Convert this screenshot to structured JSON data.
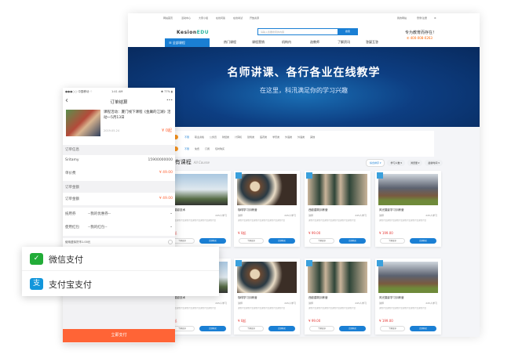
{
  "desktop": {
    "topbar": {
      "links": [
        "网站首页",
        "活动中心",
        "大家小组",
        "在线问答",
        "在线考试",
        "开放资源"
      ],
      "right": [
        "我的网站",
        "登录/注册",
        "设置"
      ]
    },
    "logo": {
      "part1": "Kesion",
      "part2": "EDU"
    },
    "search": {
      "placeholder": "请输入您要搜索的内容",
      "button": "搜索"
    },
    "slogan": "专为教育而存在！",
    "phone": "✆ 400-008-0263",
    "all_categories": "☰ 全部课程",
    "nav": [
      "热门课程",
      "课程营销",
      "机构内",
      "选教师",
      "了解资讯",
      "答疑互答"
    ],
    "banner": {
      "title": "名师讲课、各行各业在线教学",
      "subtitle": "在这里，科汛满足你的学习兴趣"
    },
    "filters": {
      "row1": [
        "不限",
        "职业资格",
        "公务员",
        "财经类",
        "计算机",
        "建筑类",
        "医药类",
        "学历类",
        "外语类",
        "外语类",
        "其他"
      ],
      "row2": [
        "不限",
        "免费",
        "订阅",
        "包时购买"
      ]
    },
    "section": {
      "title": "所有课程",
      "subtitle": "All Course",
      "sorts": [
        "综合排序 ▾",
        "学习人数 ▾",
        "浏览量 ▾",
        "最新时间 ▾"
      ]
    },
    "courses": [
      {
        "title": "学习摄影技术",
        "teacher": "讲师",
        "students": "245人学习",
        "desc": "课程介绍课程介绍课程介绍课程介绍课程介绍课程介绍",
        "price": "¥ 0起",
        "btn1": "了解更多",
        "btn2": "立即购买"
      },
      {
        "title": "咖啡学习训练营",
        "teacher": "讲师",
        "students": "245人学习",
        "desc": "课程介绍课程介绍课程介绍课程介绍课程介绍课程介绍",
        "price": "¥ 0起",
        "btn1": "了解更多",
        "btn2": "立即购买"
      },
      {
        "title": "西欧建筑训练营",
        "teacher": "讲师",
        "students": "245人学习",
        "desc": "课程介绍课程介绍课程介绍课程介绍课程介绍课程介绍",
        "price": "¥ 99.00",
        "btn1": "了解更多",
        "btn2": "立即购买"
      },
      {
        "title": "风光摄影学习训练营",
        "teacher": "讲师",
        "students": "245人学习",
        "desc": "课程介绍课程介绍课程介绍课程介绍课程介绍课程介绍",
        "price": "¥ 199.00",
        "btn1": "了解更多",
        "btn2": "立即购买"
      },
      {
        "title": "学习摄影技术",
        "teacher": "讲师",
        "students": "245人学习",
        "desc": "课程介绍课程介绍课程介绍课程介绍课程介绍课程介绍",
        "price": "¥ 0起",
        "btn1": "了解更多",
        "btn2": "立即购买"
      },
      {
        "title": "咖啡学习训练营",
        "teacher": "讲师",
        "students": "245人学习",
        "desc": "课程介绍课程介绍课程介绍课程介绍课程介绍课程介绍",
        "price": "¥ 0起",
        "btn1": "了解更多",
        "btn2": "立即购买"
      },
      {
        "title": "西欧建筑训练营",
        "teacher": "讲师",
        "students": "245人学习",
        "desc": "课程介绍课程介绍课程介绍课程介绍课程介绍课程介绍",
        "price": "¥ 99.00",
        "btn1": "了解更多",
        "btn2": "立即购买"
      },
      {
        "title": "风光摄影学习训练营",
        "teacher": "讲师",
        "students": "245人学习",
        "desc": "课程介绍课程介绍课程介绍课程介绍课程介绍课程介绍",
        "price": "¥ 199.00",
        "btn1": "了解更多",
        "btn2": "立即购买"
      }
    ]
  },
  "mobile": {
    "status": {
      "carrier": "●●●○○ 中国移动 ⌔",
      "time": "1:41 AM",
      "battery": "✱ 77% ▮"
    },
    "title": "订单结算",
    "back": "‹",
    "more": "•••",
    "product": {
      "title": "课程活动：厦门线下课程《金庸的江湖》活动一5月13日",
      "date": "2019.05.24",
      "price": "¥ 0起"
    },
    "order_info_label": "订单信息",
    "user": {
      "label": "Sritamy",
      "value": "15900000000"
    },
    "unit_price": {
      "label": "单价费",
      "value": "¥ 49.00"
    },
    "amount_section": "订单金额",
    "amount": {
      "label": "订单金额",
      "value": "¥ 49.00"
    },
    "coupon": {
      "label": "抵用券",
      "value": "--我的优惠券--"
    },
    "redpack": {
      "label": "使用红包",
      "value": "--我的红包--"
    },
    "balance": "使用虚拟货币1.00元",
    "pay_button": "立即支付"
  },
  "payment": {
    "wechat": "微信支付",
    "alipay": "支付宝支付",
    "wechat_color": "#22ac38",
    "alipay_color": "#1296db"
  }
}
